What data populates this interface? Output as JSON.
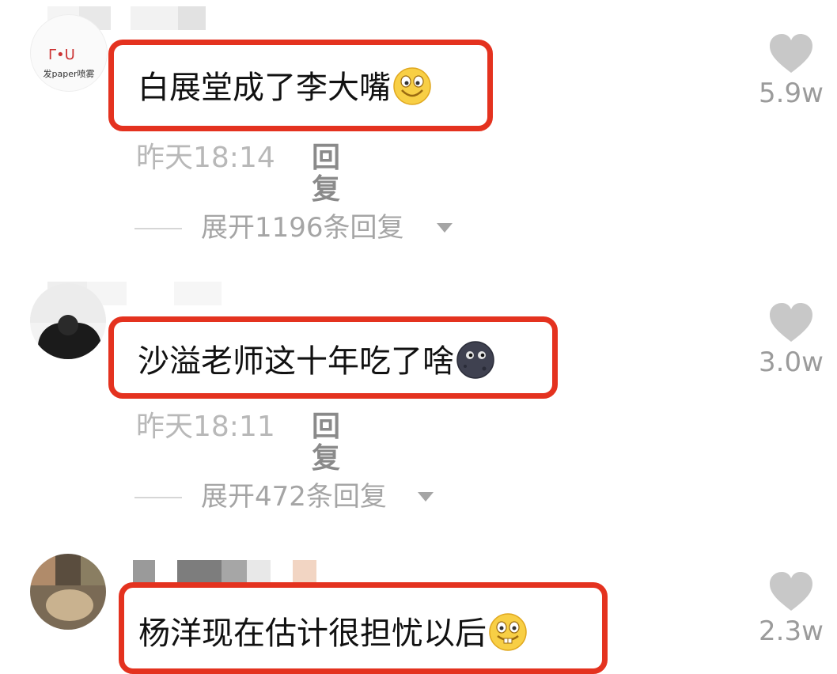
{
  "comments": [
    {
      "avatar_caption": "发paper喷雾",
      "text": "白展堂成了李大嘴",
      "emoji": "grinning-face-icon",
      "time": "昨天18:14",
      "reply_label": "回复",
      "expand_label": "展开1196条回复",
      "likes": "5.9w"
    },
    {
      "text": "沙溢老师这十年吃了啥",
      "emoji": "new-moon-face-icon",
      "time": "昨天18:11",
      "reply_label": "回复",
      "expand_label": "展开472条回复",
      "likes": "3.0w"
    },
    {
      "text": "杨洋现在估计很担忧以后",
      "emoji": "buck-teeth-face-icon",
      "likes": "2.3w"
    }
  ],
  "colors": {
    "highlight_border": "#e4321f",
    "like_icon": "#c8c8c8",
    "muted_text": "#b8b8b8"
  }
}
